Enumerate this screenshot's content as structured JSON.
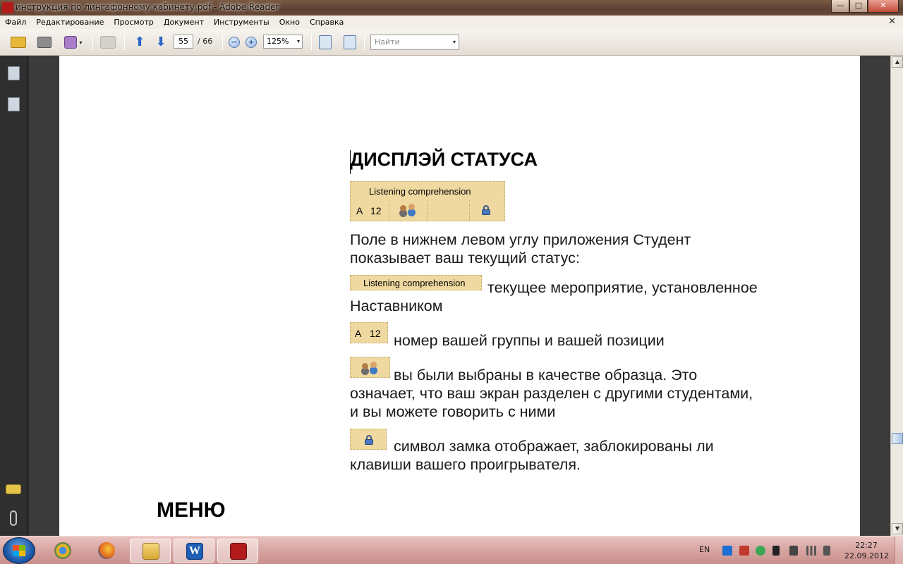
{
  "window": {
    "title": "инструкция по лингафонному кабинету.pdf - Adobe Reader",
    "buttons": {
      "minimize": "—",
      "maximize": "□",
      "close": "✕"
    }
  },
  "menu": {
    "items": [
      "Файл",
      "Редактирование",
      "Просмотр",
      "Документ",
      "Инструменты",
      "Окно",
      "Справка"
    ],
    "close_glyph": "✕"
  },
  "toolbar": {
    "current_page": "55",
    "page_total": "/ 66",
    "zoom": "125%",
    "zoom_out": "−",
    "zoom_in": "+",
    "find_placeholder": "Найти",
    "dropdown_glyph": "▾",
    "prev_glyph": "⬆",
    "next_glyph": "⬇"
  },
  "document": {
    "heading_status": "ДИСПЛЭЙ СТАТУСА",
    "widget": {
      "activity": "Listening comprehension",
      "group": "A",
      "position": "12"
    },
    "intro_line1": "Поле в нижнем левом углу приложения Студент",
    "intro_line2": "показывает ваш текущий статус:",
    "item_activity_line1": "текущее мероприятие, установленное",
    "item_activity_line2": "Наставником",
    "item_group": "номер вашей группы и вашей позиции",
    "item_model_line1": "вы были выбраны в качестве образца. Это",
    "item_model_line2": "означает, что ваш экран разделен с другими студентами,",
    "item_model_line3": "и вы можете говорить с ними",
    "item_lock_line1": "символ замка отображает, заблокированы ли",
    "item_lock_line2": "клавиши вашего проигрывателя.",
    "heading_menu": "МЕНЮ"
  },
  "scrollbar": {
    "up": "▲",
    "down": "▼"
  },
  "taskbar": {
    "word_letter": "W",
    "lang": "EN",
    "time": "22:27",
    "date": "22.09.2012"
  }
}
